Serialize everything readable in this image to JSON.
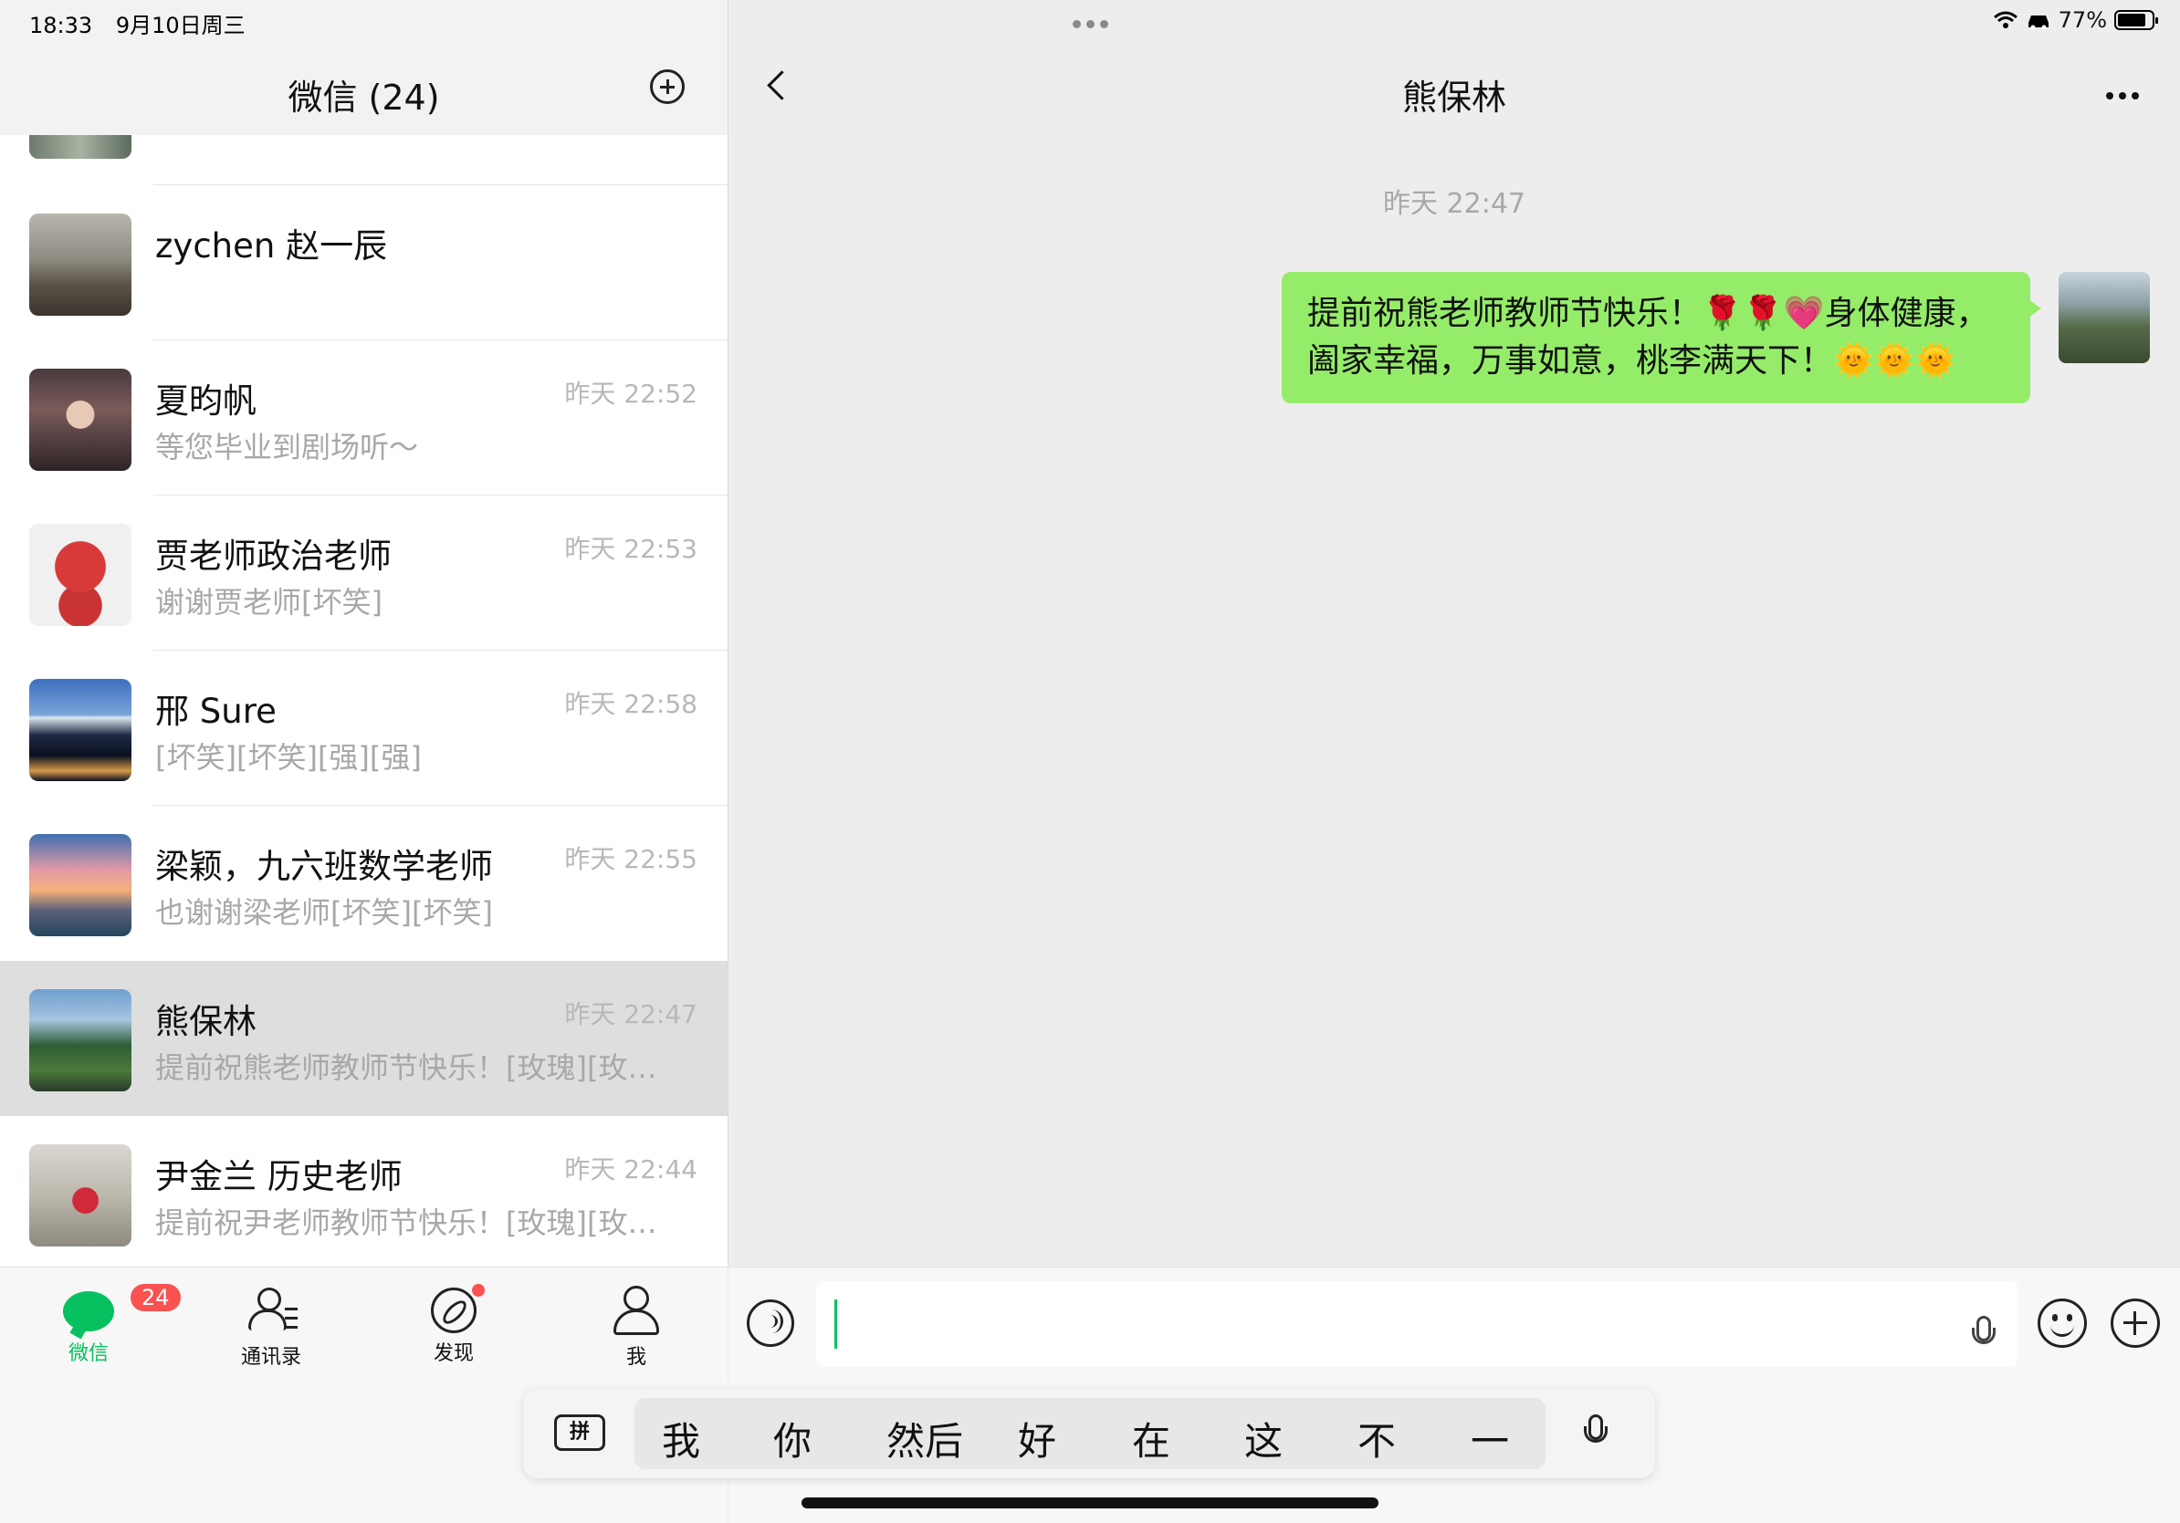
{
  "status_bar": {
    "time": "18:33",
    "date": "9月10日周三",
    "battery": "77%"
  },
  "left": {
    "title": "微信 (24)",
    "chats": [
      {
        "name": "zychen 赵一辰",
        "time": "",
        "preview": "",
        "avatar": "av-zychen"
      },
      {
        "name": "夏昀帆",
        "time": "昨天 22:52",
        "preview": "等您毕业到剧场听～",
        "avatar": "av-xia"
      },
      {
        "name": "贾老师政治老师",
        "time": "昨天 22:53",
        "preview": "谢谢贾老师[坏笑]",
        "avatar": "av-jia"
      },
      {
        "name": "邢 Sure",
        "time": "昨天 22:58",
        "preview": "[坏笑][坏笑][强][强]",
        "avatar": "av-xing"
      },
      {
        "name": "梁颖，九六班数学老师",
        "time": "昨天 22:55",
        "preview": "也谢谢梁老师[坏笑][坏笑]",
        "avatar": "av-liang"
      },
      {
        "name": "熊保林",
        "time": "昨天 22:47",
        "preview": "提前祝熊老师教师节快乐！[玫瑰][玫…",
        "avatar": "av-xiong",
        "active": true
      },
      {
        "name": "尹金兰 历史老师",
        "time": "昨天 22:44",
        "preview": "提前祝尹老师教师节快乐！[玫瑰][玫…",
        "avatar": "av-yin"
      }
    ],
    "tabs": {
      "wechat": "微信",
      "wechat_badge": "24",
      "contacts": "通讯录",
      "discover": "发现",
      "me": "我"
    }
  },
  "right": {
    "title": "熊保林",
    "timestamp": "昨天 22:47",
    "message_line1": "提前祝熊老师教师节快乐！🌹🌹💗身体健康，",
    "message_line2": "阖家幸福，万事如意，桃李满天下！🌞🌞🌞"
  },
  "ime": {
    "key_label": "拼",
    "candidates": [
      "我",
      "你",
      "然后",
      "好",
      "在",
      "这",
      "不",
      "一"
    ]
  }
}
